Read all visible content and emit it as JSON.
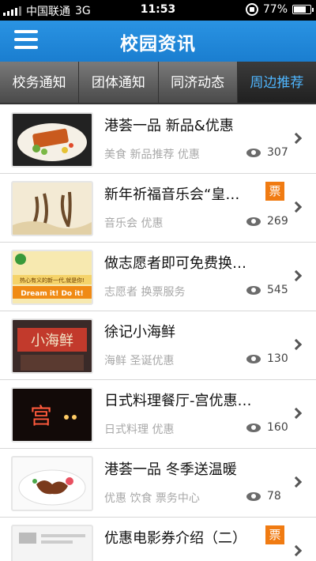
{
  "status_bar": {
    "carrier": "中国联通",
    "network": "3G",
    "time": "11:53",
    "battery": "77%",
    "battery_level": 0.77
  },
  "header": {
    "title": "校园资讯",
    "menu_icon": "hamburger-menu-icon"
  },
  "tabs": [
    {
      "label": "校务通知",
      "active": false
    },
    {
      "label": "团体通知",
      "active": false
    },
    {
      "label": "同济动态",
      "active": false
    },
    {
      "label": "周边推荐",
      "active": true
    }
  ],
  "items": [
    {
      "title": "港荟一品 新品&优惠",
      "tags": "美食 新品推荐 优惠",
      "views": "307",
      "ticket": ""
    },
    {
      "title": "新年祈福音乐会“皇…",
      "tags": "音乐会 优惠",
      "views": "269",
      "ticket": "票"
    },
    {
      "title": "做志愿者即可免费换…",
      "tags": "志愿者 换票服务",
      "views": "545",
      "ticket": ""
    },
    {
      "title": "徐记小海鲜",
      "tags": "海鲜 圣诞优惠",
      "views": "130",
      "ticket": ""
    },
    {
      "title": "日式料理餐厅-宫优惠…",
      "tags": "日式料理 优惠",
      "views": "160",
      "ticket": ""
    },
    {
      "title": "港荟一品 冬季送温暖",
      "tags": "优惠 饮食 票务中心",
      "views": "78",
      "ticket": ""
    },
    {
      "title": "优惠电影券介绍（二）",
      "tags": "",
      "views": "",
      "ticket": "票"
    }
  ],
  "thumb_text": {
    "item3_line1": "热心有义的新一代,就是你!",
    "item3_line2": "Dream it!  Do it!",
    "item4_sign": "小海鲜",
    "item5_sign": "宫"
  }
}
